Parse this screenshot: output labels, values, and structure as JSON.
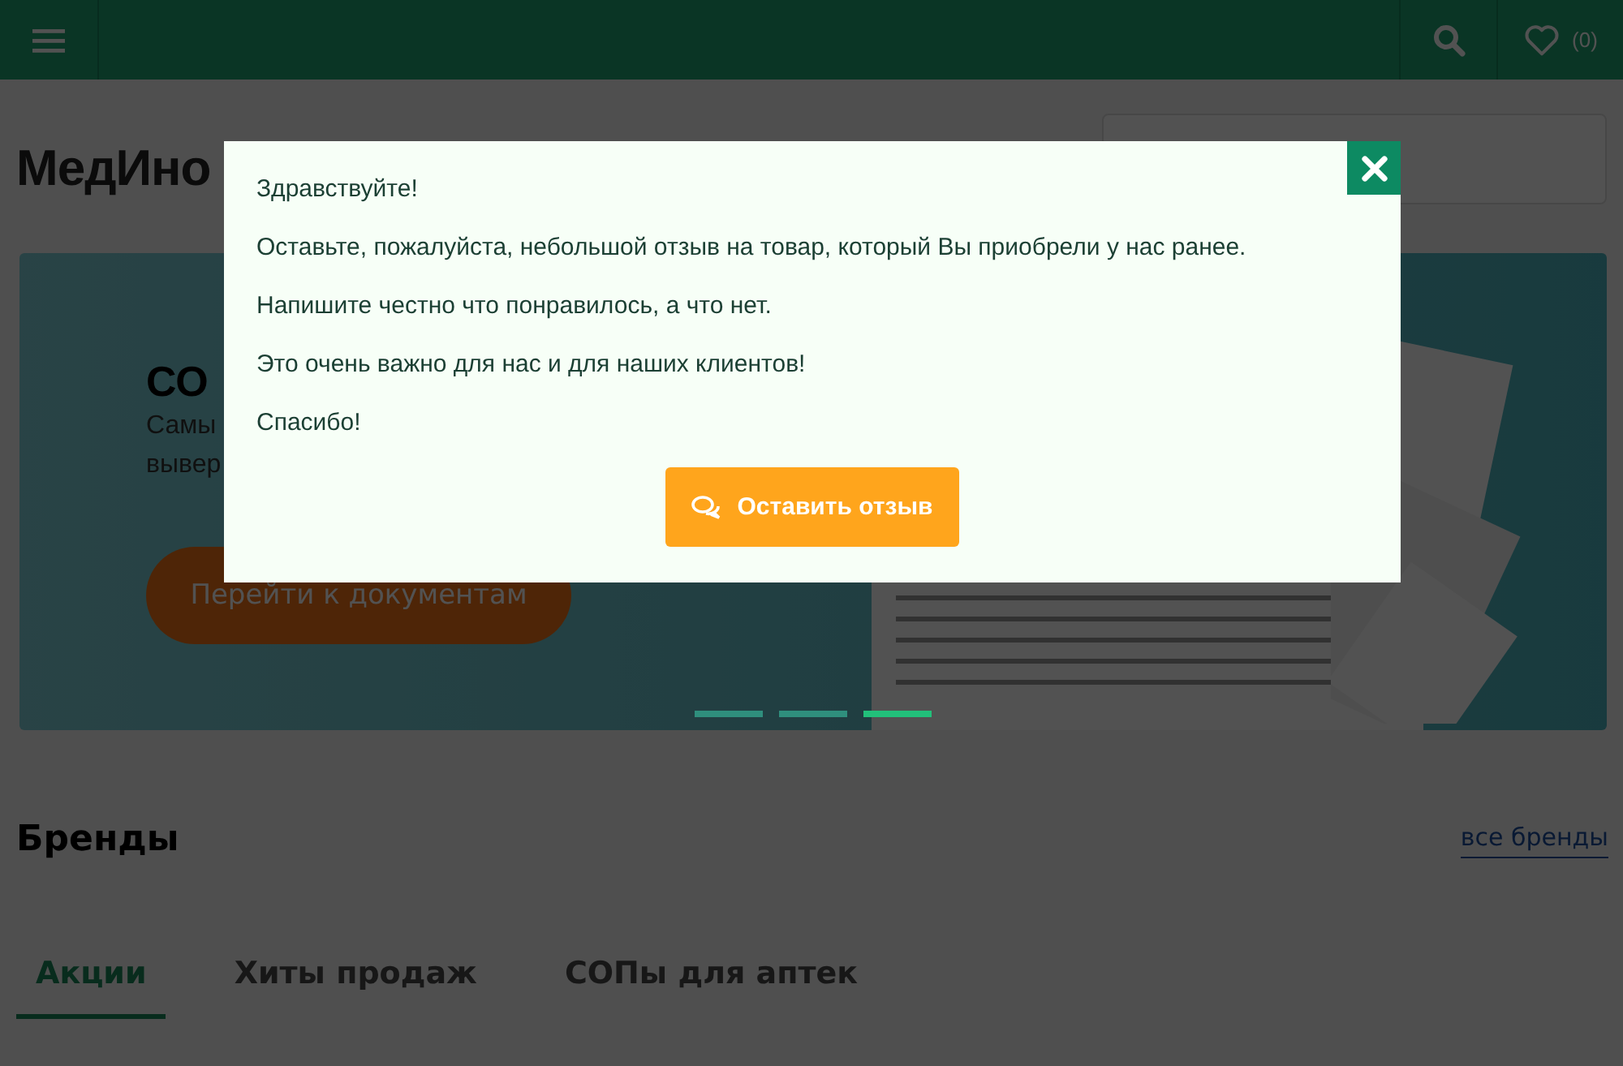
{
  "header": {
    "wishlist_count": "(0)"
  },
  "logo": "МедИно",
  "banner": {
    "title": "СО",
    "text_lines": [
      "Самы",
      "вывер"
    ],
    "button": "Перейти к документам",
    "dots": [
      {
        "selected": false
      },
      {
        "selected": false
      },
      {
        "selected": true
      }
    ]
  },
  "brands": {
    "title": "Бренды",
    "link": "все бренды"
  },
  "tabs": [
    {
      "label": "Акции",
      "selected": true
    },
    {
      "label": "Хиты продаж",
      "selected": false
    },
    {
      "label": "СОПы для аптек",
      "selected": false
    }
  ],
  "modal": {
    "paragraphs": [
      "Здравствуйте!",
      "Оставьте, пожалуйста, небольшой отзыв на товар, который Вы приобрели у нас ранее.",
      "Напишите честно что понравилось, а что нет.",
      "Это очень важно для нас и для наших клиентов!",
      "Спасибо!"
    ],
    "button": "Оставить отзыв"
  }
}
